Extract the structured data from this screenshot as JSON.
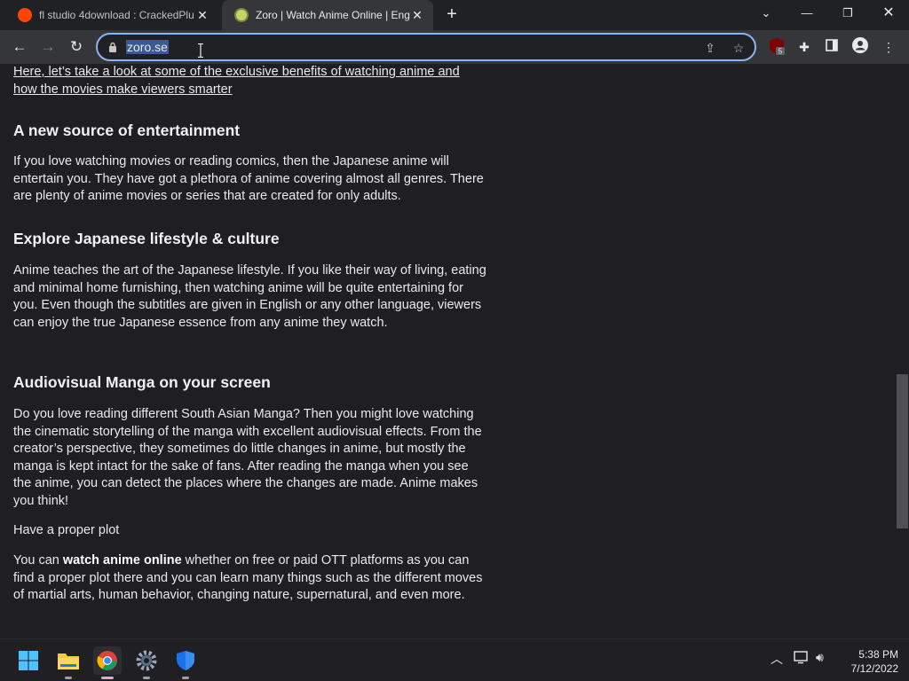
{
  "browser": {
    "tabs": [
      {
        "title": "fl studio 4download : CrackedPlu",
        "favicon": "reddit-icon",
        "active": false
      },
      {
        "title": "Zoro | Watch Anime Online | Eng",
        "favicon": "zoro-icon",
        "active": true
      }
    ],
    "url": "zoro.se",
    "extension_badge": "5"
  },
  "article": {
    "intro_link": "Here, let’s take a look at some of the exclusive benefits of watching anime and how the movies make viewers smarter",
    "sections": [
      {
        "heading": "A new source of entertainment",
        "body": "If you love watching movies or reading comics, then the Japanese anime will entertain you. They have got a plethora of anime covering almost all genres. There are plenty of anime movies or series that are created for only adults."
      },
      {
        "heading": "Explore Japanese lifestyle & culture",
        "body": "Anime teaches the art of the Japanese lifestyle. If you like their way of living, eating and minimal home furnishing, then watching anime will be quite entertaining for you. Even though the subtitles are given in English or any other language, viewers can enjoy the true Japanese essence from any anime they watch."
      },
      {
        "heading": "Audiovisual Manga on your screen",
        "body": "Do you love reading different South Asian Manga? Then you might love watching the cinematic storytelling of the manga with excellent audiovisual effects. From the creator’s perspective, they sometimes do little changes in anime, but mostly the manga is kept intact for the sake of fans. After reading the manga when you see the anime, you can detect the places where the changes are made. Anime makes you think!"
      }
    ],
    "plot_line": "Have a proper plot",
    "last_para": {
      "before": "You can ",
      "bold": "watch anime online",
      "after": " whether on free or paid OTT platforms as you can find a proper plot there and you can learn many things such as the different moves of martial arts, human behavior, changing nature, supernatural, and even more."
    }
  },
  "taskbar": {
    "apps": [
      "windows-start-icon",
      "file-explorer-icon",
      "chrome-icon",
      "settings-icon",
      "windows-security-icon"
    ],
    "time": "5:38 PM",
    "date": "7/12/2022"
  },
  "colors": {
    "background": "#1e1e23",
    "text": "#e8eaed",
    "omnibox_focus": "#8ab4f8",
    "url_selection": "#3b5b8f"
  }
}
